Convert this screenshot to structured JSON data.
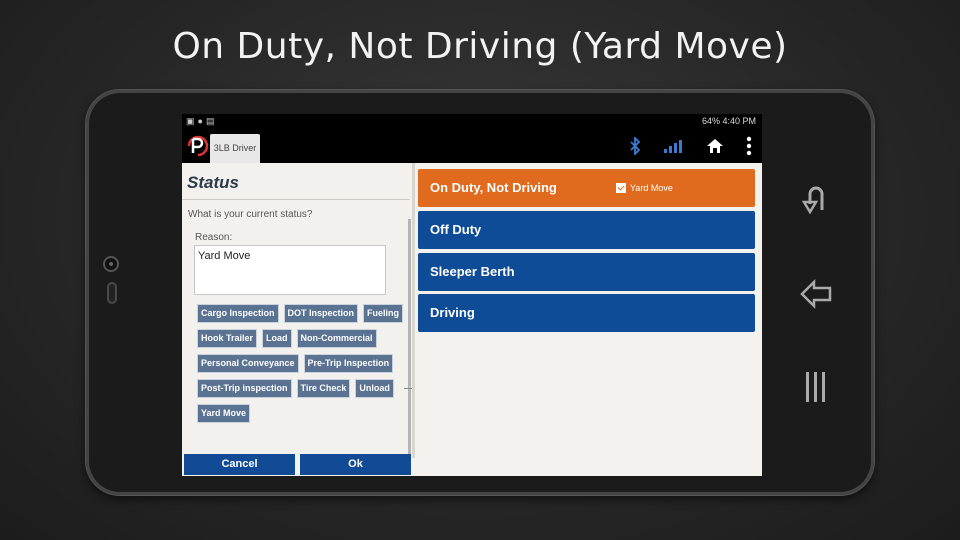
{
  "slide": {
    "title": "On Duty, Not Driving (Yard Move)"
  },
  "statusbar": {
    "right_text": "64% 4:40 PM"
  },
  "app": {
    "tab_label": "3LB Driver"
  },
  "status_panel": {
    "title": "Status",
    "question": "What is your current status?",
    "reason_label": "Reason:",
    "reason_value": "Yard Move",
    "chips": [
      [
        "Cargo Inspection",
        "DOT Inspection",
        "Fueling"
      ],
      [
        "Hook Trailer",
        "Load",
        "Non-Commercial"
      ],
      [
        "Personal Conveyance",
        "Pre-Trip Inspection"
      ],
      [
        "Post-Trip inspection",
        "Tire Check",
        "Unload"
      ],
      [
        "Yard Move"
      ]
    ]
  },
  "buttons": {
    "cancel": "Cancel",
    "ok": "Ok"
  },
  "statuses": {
    "on_duty": "On Duty, Not Driving",
    "yard_move": "Yard Move",
    "off_duty": "Off Duty",
    "sleeper": "Sleeper Berth",
    "driving": "Driving"
  },
  "colors": {
    "active": "#e06a1e",
    "status_blue": "#0f4c97",
    "chip": "#5a7393"
  },
  "icons": [
    "bluetooth-icon",
    "signal-icon",
    "home-icon",
    "overflow-menu-icon",
    "back-icon",
    "recent-apps-icon",
    "menu-icon"
  ]
}
